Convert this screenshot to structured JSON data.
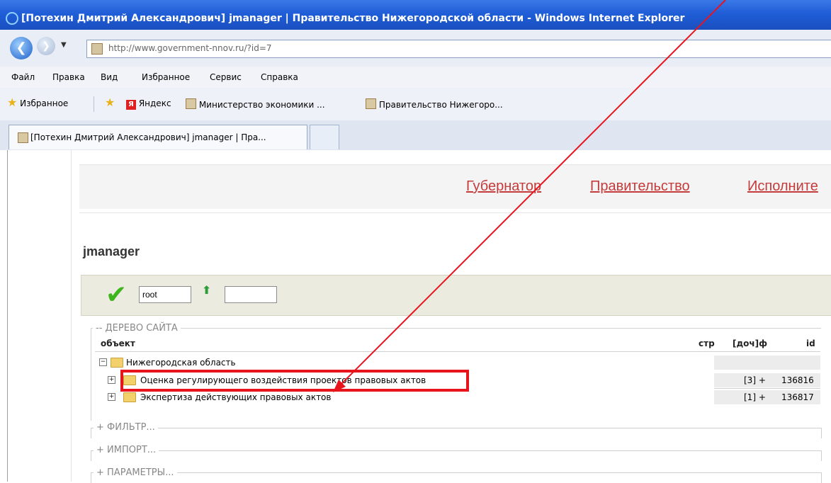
{
  "window": {
    "title": "[Потехин Дмитрий Александрович] jmanager | Правительство Нижегородской области - Windows Internet Explorer"
  },
  "address": {
    "url": "http://www.government-nnov.ru/?id=7"
  },
  "menu": {
    "items": [
      "Файл",
      "Правка",
      "Вид",
      "Избранное",
      "Сервис",
      "Справка"
    ]
  },
  "favorites": {
    "label": "Избранное",
    "items": [
      "Яндекс",
      "Министерство экономики ...",
      "Правительство Нижегоро..."
    ]
  },
  "tabs": {
    "active_label": "[Потехин Дмитрий Александрович] jmanager | Пра..."
  },
  "nav": {
    "links": [
      "Губернатор",
      "Правительство",
      "Исполните"
    ]
  },
  "page": {
    "heading": "jmanager",
    "root_input_value": "root"
  },
  "tree": {
    "legend": "-- ДЕРЕВО САЙТА",
    "columns": [
      "объект",
      "стр",
      "[доч]ф",
      "id"
    ],
    "rows": [
      {
        "name": "Нижегородская область",
        "children": "",
        "id": ""
      },
      {
        "name": "Оценка регулирующего воздействия проектов правовых актов",
        "children": "[3] +",
        "id": "136816"
      },
      {
        "name": "Экспертиза действующих правовых актов",
        "children": "[1] +",
        "id": "136817"
      }
    ]
  },
  "sections": [
    "+ ФИЛЬТР...",
    "+ ИМПОРТ...",
    "+ ПАРАМЕТРЫ..."
  ],
  "annotation": {
    "color": "#e8141c"
  }
}
